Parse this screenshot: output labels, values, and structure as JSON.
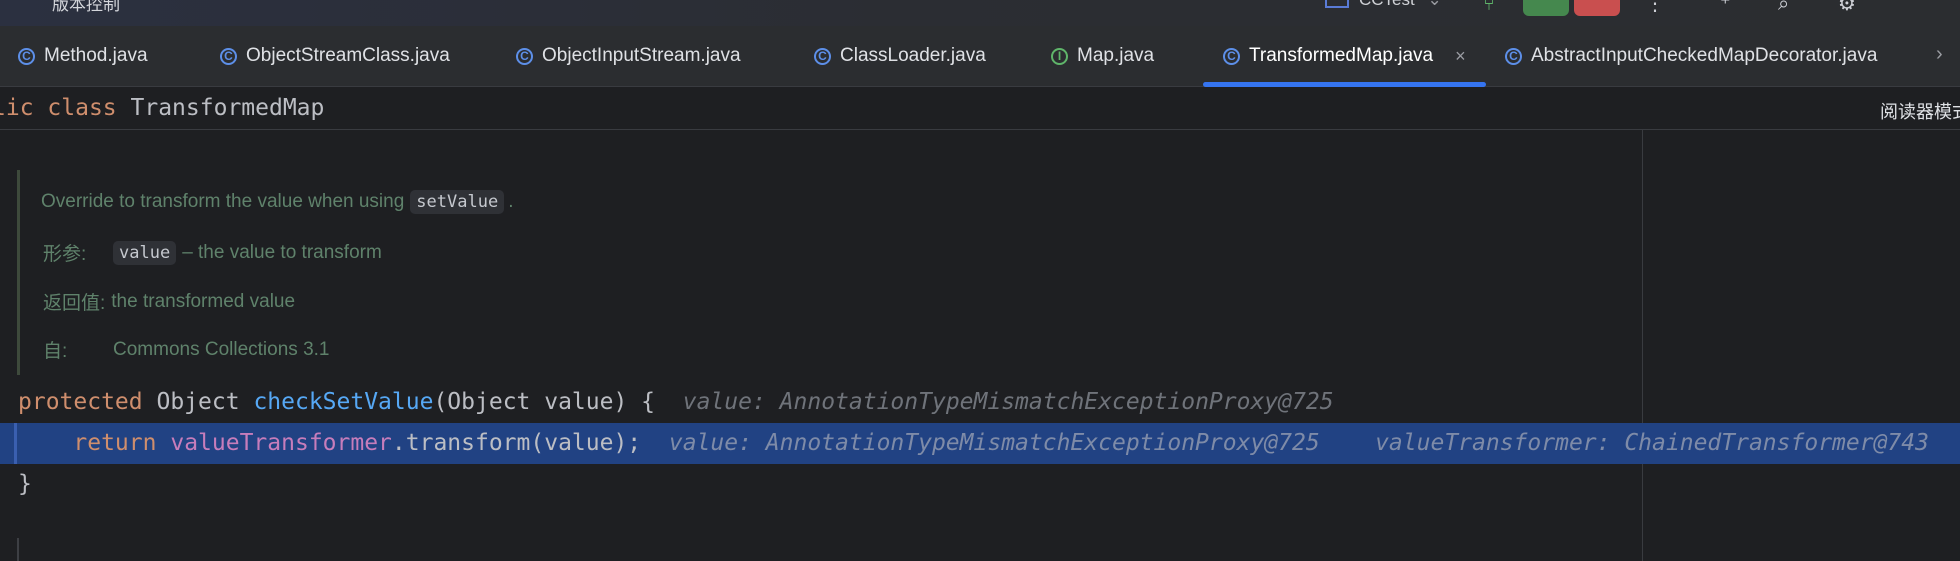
{
  "titlebar": {
    "project": "版本控制",
    "run_config": "CCTest",
    "run_config_chevron": "⌄"
  },
  "tabs": [
    {
      "label": "Method.java",
      "icon": "class-icon"
    },
    {
      "label": "ObjectStreamClass.java",
      "icon": "class-icon"
    },
    {
      "label": "ObjectInputStream.java",
      "icon": "class-icon"
    },
    {
      "label": "ClassLoader.java",
      "icon": "class-icon"
    },
    {
      "label": "Map.java",
      "icon": "interface-icon"
    },
    {
      "label": "TransformedMap.java",
      "icon": "class-icon",
      "active": true
    },
    {
      "label": "AbstractInputCheckedMapDecorator.java",
      "icon": "class-icon"
    }
  ],
  "tab_icon_letter": {
    "class": "C",
    "interface": "I"
  },
  "tab_close_glyph": "×",
  "sticky": {
    "keyword_partial": "lic",
    "keyword_class": "class",
    "class_name": "TransformedMap",
    "reader_mode": "阅读器模式"
  },
  "doc": {
    "summary_text": "Override to transform the value when using",
    "summary_code": "setValue",
    "summary_end": ".",
    "param_tag": "形参:",
    "param_code": "value",
    "param_text": "– the value to transform",
    "return_tag": "返回值:",
    "return_text": "the transformed value",
    "since_tag": "自:",
    "since_text": "Commons Collections 3.1"
  },
  "code": {
    "line1": {
      "kw": "protected",
      "type": "Object",
      "method": "checkSetValue",
      "params": "(Object value) {",
      "hint": "value: AnnotationTypeMismatchExceptionProxy@725"
    },
    "line2": {
      "kw": "return",
      "field": "valueTransformer",
      "call": ".transform(value);",
      "hint1": "value: AnnotationTypeMismatchExceptionProxy@725",
      "hint2": "valueTransformer: ChainedTransformer@743"
    },
    "line3": "}"
  },
  "colors": {
    "editor_bg": "#1e1f22",
    "keyword": "#cf8e6d",
    "method": "#56a8f5",
    "field": "#c77dbb",
    "doc": "#5f826b",
    "exec_highlight": "#214283",
    "tab_underline": "#3574f0"
  }
}
